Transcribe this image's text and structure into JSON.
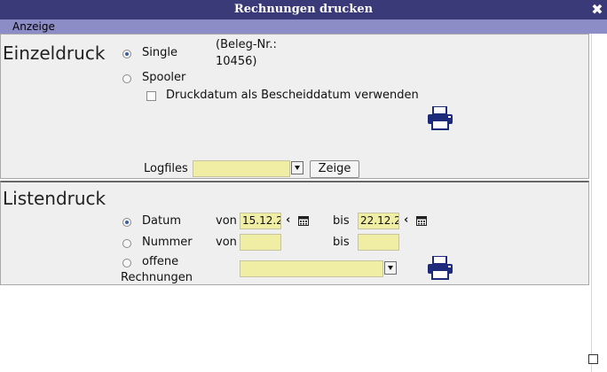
{
  "window": {
    "title": "Rechnungen drucken",
    "close_symbol": "✖"
  },
  "menu": {
    "items": [
      {
        "label": "Anzeige"
      }
    ]
  },
  "einzeldruck": {
    "title": "Einzeldruck",
    "options": [
      {
        "label": "Single",
        "checked": true
      },
      {
        "label": "Spooler",
        "checked": false
      }
    ],
    "beleg_label": "(Beleg-Nr.:",
    "beleg_value": "10456)",
    "checkbox_label": "Druckdatum als Bescheiddatum verwenden",
    "checkbox_checked": false,
    "logfiles_label": "Logfiles",
    "logfiles_value": "",
    "zeige_label": "Zeige",
    "print_icon": "printer-icon"
  },
  "listendruck": {
    "title": "Listendruck",
    "rows": [
      {
        "label": "Datum",
        "checked": true,
        "von_label": "von",
        "von_value": "15.12.2",
        "bis_label": "bis",
        "bis_value": "22.12.2"
      },
      {
        "label": "Nummer",
        "checked": false,
        "von_label": "von",
        "von_value": "",
        "bis_label": "bis",
        "bis_value": ""
      }
    ],
    "offene_label_1": "offene",
    "offene_label_2": "Rechnungen",
    "offene_value": "",
    "nav_icon": "chevron-left-icon",
    "calendar_icon": "calendar-icon",
    "print_icon": "printer-icon"
  },
  "colors": {
    "titlebar": "#3a3a78",
    "menubar": "#8c8cc6",
    "field": "#f0eda4",
    "printer": "#1e2b7a"
  }
}
